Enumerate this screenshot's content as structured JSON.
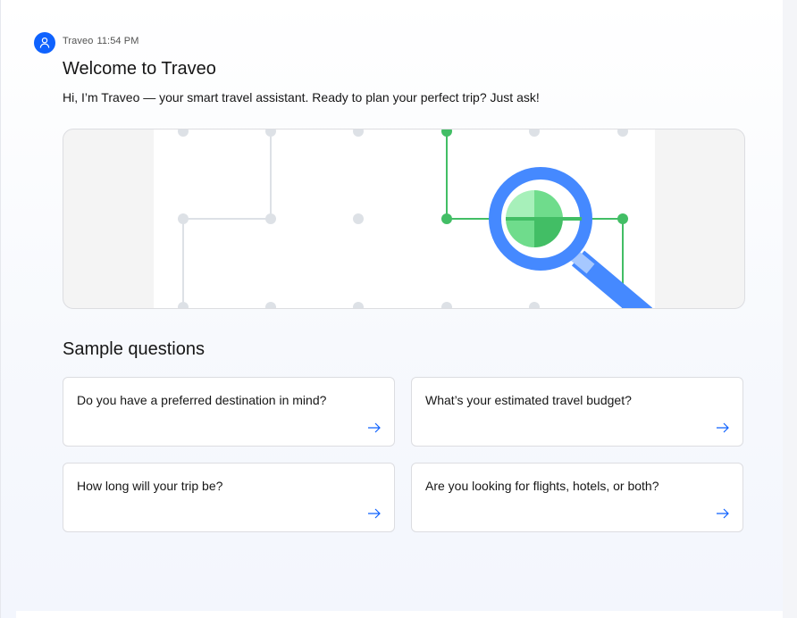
{
  "message": {
    "sender": "Traveo",
    "time": "11:54 PM",
    "avatar_icon": "user-icon",
    "title": "Welcome to Traveo",
    "intro": "Hi, I’m Traveo — your smart travel assistant. Ready to plan your perfect trip? Just ask!"
  },
  "illustration": {
    "icon": "magnifying-glass-icon",
    "colors": {
      "accent_blue": "#4589ff",
      "path_green": "#42be65",
      "node_gray": "#dde1e6"
    }
  },
  "samples": {
    "heading": "Sample questions",
    "questions": [
      "Do you have a preferred destination in mind?",
      "What’s your estimated travel budget?",
      "How long will your trip be?",
      "Are you looking for flights, hotels, or both?"
    ],
    "arrow_icon": "arrow-right-icon",
    "arrow_color": "#0f62fe"
  }
}
